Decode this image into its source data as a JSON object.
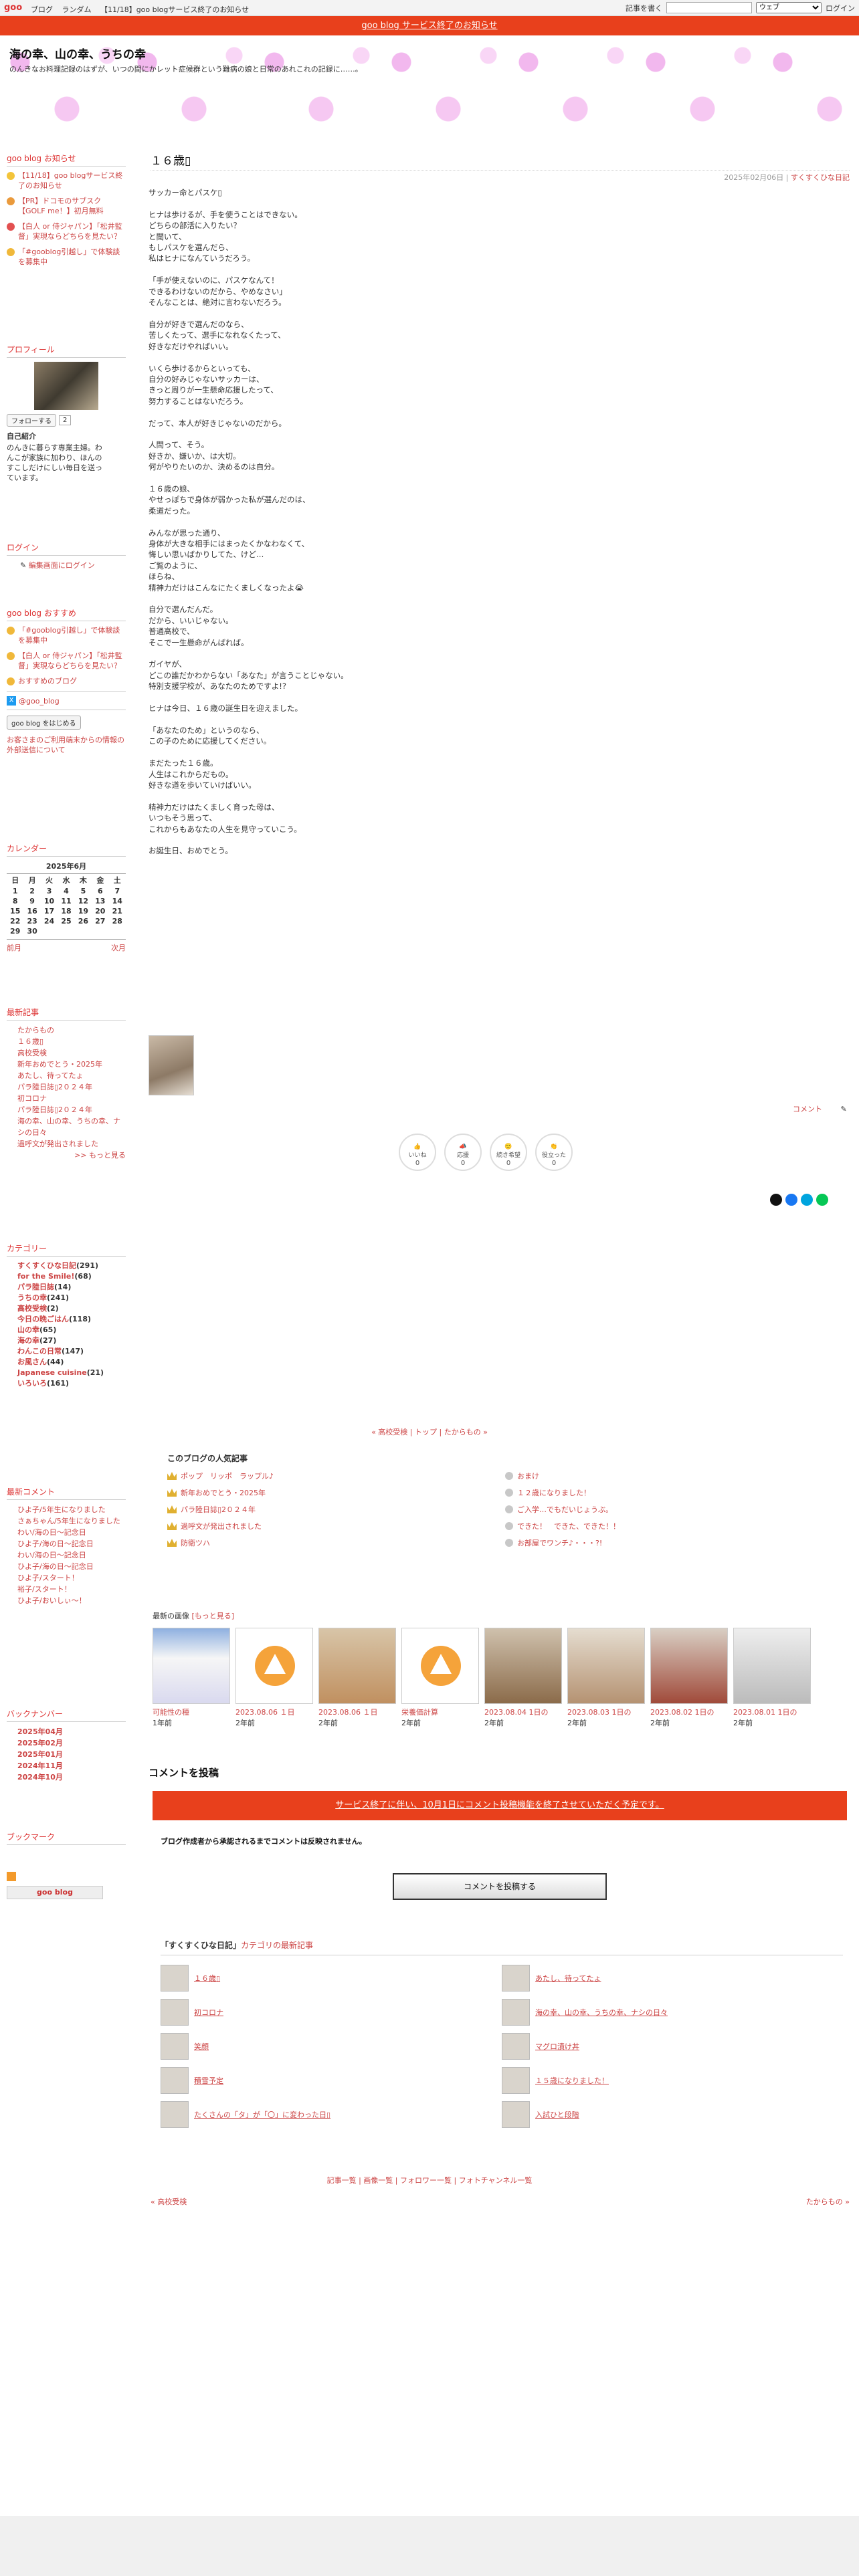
{
  "topbar": {
    "logo": "goo",
    "links": [
      "ブログ",
      "ランダム",
      "【11/18】goo blogサービス終了のお知らせ"
    ],
    "write_label": "記事を書く",
    "search_select": "ウェブ",
    "login_label": "ログイン"
  },
  "notice_bar": "goo blog サービス終了のお知らせ",
  "blog": {
    "title": "海の幸、山の幸、うちの幸",
    "description": "のんきなお料理記録のはずが、いつの間にかレット症候群という難病の娘と日常のあれこれの記録に……。"
  },
  "sidebar": {
    "news_head": "goo blog お知らせ",
    "news": [
      "【11/18】goo blogサービス終了のお知らせ",
      "【PR】ドコモのサブスク【GOLF me！】初月無料",
      "【白人 or 侍ジャパン】「松井監督」実現ならどちらを見たい？",
      "「#gooblog引越し」で体験談を募集中"
    ],
    "profile_head": "プロフィール",
    "follow_label": "フォローする",
    "follow_count": "2",
    "intro_head": "自己紹介",
    "intro_text": "のんきに暮らす専業主婦。わんこが家族に加わり、ほんのすこしだけにしい毎日を送っています。",
    "login_head": "ログイン",
    "login_link": "編集画面にログイン",
    "reco_head": "goo blog おすすめ",
    "reco": [
      "「#gooblog引越し」で体験談を募集中",
      "【白人 or 侍ジャパン】「松井監督」実現ならどちらを見たい？",
      "おすすめのブログ"
    ],
    "x_account": "@goo_blog",
    "start_btn": "goo blog をはじめる",
    "ext_info": "お客さまのご利用端末からの情報の外部送信について",
    "calendar_head": "カレンダー",
    "calendar_month": "2025年6月",
    "calendar_days": [
      "日",
      "月",
      "火",
      "水",
      "木",
      "金",
      "土"
    ],
    "calendar_rows": [
      [
        "1",
        "2",
        "3",
        "4",
        "5",
        "6",
        "7"
      ],
      [
        "8",
        "9",
        "10",
        "11",
        "12",
        "13",
        "14"
      ],
      [
        "15",
        "16",
        "17",
        "18",
        "19",
        "20",
        "21"
      ],
      [
        "22",
        "23",
        "24",
        "25",
        "26",
        "27",
        "28"
      ],
      [
        "29",
        "30",
        "",
        "",
        "",
        "",
        ""
      ]
    ],
    "calendar_prev": "前月",
    "calendar_next": "次月",
    "recent_head": "最新記事",
    "recent": [
      "たからもの",
      "１６歳▯",
      "高校受検",
      "新年おめでとう・2025年",
      "あたし、待ってたょ",
      "パラ陸日誌▯2０２４年",
      "初コロナ",
      "パラ陸日誌▯2０２４年",
      "海の幸、山の幸、うちの幸、ナシの日々",
      "過呼文が発出されました"
    ],
    "recent_more": ">> もっと見る",
    "cat_head": "カテゴリー",
    "cats": [
      {
        "name": "すくすくひな日記",
        "count": "(291)"
      },
      {
        "name": "for the Smile!",
        "count": "(68)"
      },
      {
        "name": "パラ陸日誌",
        "count": "(14)"
      },
      {
        "name": "うちの幸",
        "count": "(241)"
      },
      {
        "name": "高校受検",
        "count": "(2)"
      },
      {
        "name": "今日の晩ごはん",
        "count": "(118)"
      },
      {
        "name": "山の幸",
        "count": "(65)"
      },
      {
        "name": "海の幸",
        "count": "(27)"
      },
      {
        "name": "わんこの日常",
        "count": "(147)"
      },
      {
        "name": "お風さん",
        "count": "(44)"
      },
      {
        "name": "Japanese cuisine",
        "count": "(21)"
      },
      {
        "name": "いろいろ",
        "count": "(161)"
      }
    ],
    "comments_head": "最新コメント",
    "comments": [
      "ひよ子/5年生になりました",
      "さぁちゃん/5年生になりました",
      "わい/海の日～記念日",
      "ひよ子/海の日～記念日",
      "わい/海の日～記念日",
      "ひよ子/海の日～記念日",
      "ひよ子/スタート！",
      "裕子/スタート！",
      "ひよ子/おいしぃ～！"
    ],
    "backnumber_head": "バックナンバー",
    "backnumbers": [
      "2025年04月",
      "2025年02月",
      "2025年01月",
      "2024年11月",
      "2024年10月"
    ],
    "bookmark_head": "ブックマーク",
    "goo_blog_badge": "goo blog"
  },
  "post": {
    "title": "１６歳▯",
    "date": "2025年02月06日",
    "category": "すくすくひな日記",
    "body": "サッカー命とパスケ▯\n\nヒナは歩けるが、手を使うことはできない。\nどちらの部活に入りたい？\nと聞いて、\nもしパスケを選んだら、\n私はヒナになんていうだろう。\n\n「手が使えないのに、パスケなんて！\nできるわけないのだから、やめなさい」\nそんなことは、絶対に言わないだろう。\n\n自分が好きで選んだのなら、\n苦しくたって、選手になれなくたって、\n好きなだけやればいい。\n\nいくら歩けるからといっても、\n自分の好みじゃないサッカーは、\nきっと周りが一生懸命応援したって、\n努力することはないだろう。\n\nだって、本人が好きじゃないのだから。\n\n人間って、そう。\n好きか、嫌いか、は大切。\n何がやりたいのか、決めるのは自分。\n\n１６歳の娘、\nやせっぽちで身体が弱かった私が選んだのは、\n柔道だった。\n\nみんなが思った通り、\n身体が大きな相手にはまったくかなわなくて、\n悔しい思いばかりしてた、けど…\nご覧のように、\nほらね、\n精神力だけはこんなにたくましくなったよ😭\n\n自分で選んだんだ。\nだから、いいじゃない。\n普通高校で、\nそこで一生懸命がんばれば。\n\nガイヤが、\nどこの誰だかわからない「あなた」が言うことじゃない。\n特別支援学校が、あなたのためですよ!?\n\nヒナは今日、１６歳の誕生日を迎えました。\n\n「あなたのため」というのなら、\nこの子のために応援してください。\n\nまだたった１６歳。\n人生はこれからだもの。\n好きな道を歩いていけばいい。\n\n精神力だけはたくましく育った母は、\nいつもそう思って、\nこれからもあなたの人生を見守っていこう。\n\nお誕生日、おめでとう。",
    "comment_link": "コメント"
  },
  "reactions": [
    {
      "label": "いいね",
      "count": "0"
    },
    {
      "label": "応援",
      "count": "0"
    },
    {
      "label": "続き希望",
      "count": "0"
    },
    {
      "label": "役立った",
      "count": "0"
    }
  ],
  "pagenav": {
    "prev": "« 高校受検",
    "top": "トップ",
    "next": "たからもの »"
  },
  "popular": {
    "head": "このブログの人気記事",
    "left": [
      "ポップ　リッポ　ラップル♪",
      "新年おめでとう・2025年",
      "パラ陸日誌▯2０２４年",
      "過呼文が発出されました",
      "防衛ツハ"
    ],
    "right": [
      "おまけ",
      "１２歳になりました！",
      "ご入学…でもだいじょうぶ。",
      "できた！　できた、できた！！",
      "お部屋でワンチ♪・・・?!"
    ]
  },
  "recent_images": {
    "head": "最新の画像",
    "more": "[もっと見る]",
    "items": [
      {
        "date": "可能性の種",
        "ago": "1年前"
      },
      {
        "date": "2023.08.06 １日",
        "ago": "2年前"
      },
      {
        "date": "2023.08.06 １日",
        "ago": "2年前"
      },
      {
        "date": "栄養価計算",
        "ago": "2年前"
      },
      {
        "date": "2023.08.04 1日の",
        "ago": "2年前"
      },
      {
        "date": "2023.08.03 1日の",
        "ago": "2年前"
      },
      {
        "date": "2023.08.02 1日の",
        "ago": "2年前"
      },
      {
        "date": "2023.08.01 1日の",
        "ago": "2年前"
      }
    ]
  },
  "comments_section": {
    "head": "コメントを投稿",
    "notice": "サービス終了に伴い、10月1日にコメント投稿機能を終了させていただく予定です。",
    "approval": "ブログ作成者から承認されるまでコメントは反映されません。",
    "button": "コメントを投稿する"
  },
  "latest": {
    "head_prefix": "「すくすくひな日記」",
    "head_suffix": "カテゴリの最新記事",
    "left": [
      "１６歳▯",
      "初コロナ",
      "笑顔",
      "積雪予定",
      "たくさんの「タ」が「〇」に変わった日▯"
    ],
    "right": [
      "あたし、待ってたょ",
      "海の幸、山の幸、うちの幸、ナシの日々",
      "マグロ漬け丼",
      "１５歳になりました！",
      "入試ひと段階"
    ]
  },
  "footer": {
    "links": "記事一覧 | 画像一覧 | フォロワー一覧 | フォトチャンネル一覧",
    "prev": "« 高校受検",
    "next": "たからもの »"
  }
}
